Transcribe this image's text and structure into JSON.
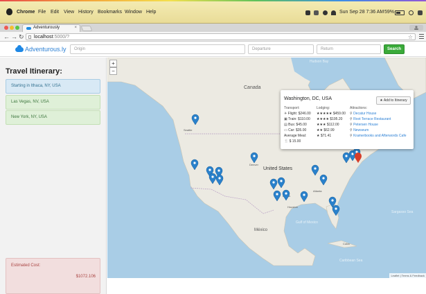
{
  "menubar": {
    "app": "Chrome",
    "items": [
      "File",
      "Edit",
      "View",
      "History",
      "Bookmarks",
      "Window",
      "Help"
    ],
    "battery": "59%",
    "clock": "Sun Sep 28  7:36 AM"
  },
  "browser": {
    "tab_title": "Adventurously",
    "url_host": "localhost",
    "url_path": ":5000/?"
  },
  "header": {
    "brand": "Adventurous.ly",
    "origin_placeholder": "Origin",
    "departure_placeholder": "Departure",
    "return_placeholder": "Return",
    "search_label": "Search",
    "accent_color": "#3aaa3a",
    "brand_color": "#2a7fd4"
  },
  "sidebar": {
    "title": "Travel Itinerary:",
    "stops": [
      {
        "label": "Starting in Ithaca, NY, USA",
        "kind": "start"
      },
      {
        "label": "Las Vegas, NV, USA",
        "kind": "leg"
      },
      {
        "label": "New York, NY, USA",
        "kind": "leg"
      }
    ],
    "cost_label": "Estimated Cost:",
    "cost_value": "$1072.106"
  },
  "map": {
    "zoom_in": "+",
    "zoom_out": "−",
    "labels": {
      "canada": "Canada",
      "united_states": "United States",
      "mexico": "México",
      "cuba": "Cuba",
      "hudson_bay": "Hudson Bay",
      "gulf_of_mexico": "Gulf of Mexico",
      "sargasso_sea": "Sargasso Sea",
      "caribbean_sea": "Caribbean Sea",
      "seattle": "Seattle",
      "denver": "Denver",
      "dallas": "Dallas",
      "houston": "Houston",
      "atlanta": "Atlanta",
      "chicago": "Chicago"
    },
    "attribution": "Leaflet | Terms & Feedback"
  },
  "popup": {
    "city": "Washington, DC, USA",
    "add_button": "★ Add to Itinerary",
    "transport_header": "Transport:",
    "lodging_header": "Lodging:",
    "attractions_header": "Attractions:",
    "transport": [
      {
        "icon": "plane-icon",
        "text": "Flight: $246.00"
      },
      {
        "icon": "train-icon",
        "text": "Train: $110.00"
      },
      {
        "icon": "bus-icon",
        "text": "Bus: $45.00"
      },
      {
        "icon": "car-icon",
        "text": "Car: $35.00"
      }
    ],
    "meal_label": "Average Meal:",
    "meal_value": "$ 15.00",
    "lodging": [
      {
        "stars": "★★★★★",
        "price": "$459.00"
      },
      {
        "stars": "★★★★",
        "price": "$195.20"
      },
      {
        "stars": "★★★",
        "price": "$112.00"
      },
      {
        "stars": "★★",
        "price": "$62.99"
      },
      {
        "stars": "★",
        "price": "$71.41"
      }
    ],
    "attractions": [
      "Decatur House",
      "Root Terrace Restaurant",
      "Petersen House",
      "Newseum",
      "Kramerbooks and Afterwords Cafe"
    ]
  }
}
